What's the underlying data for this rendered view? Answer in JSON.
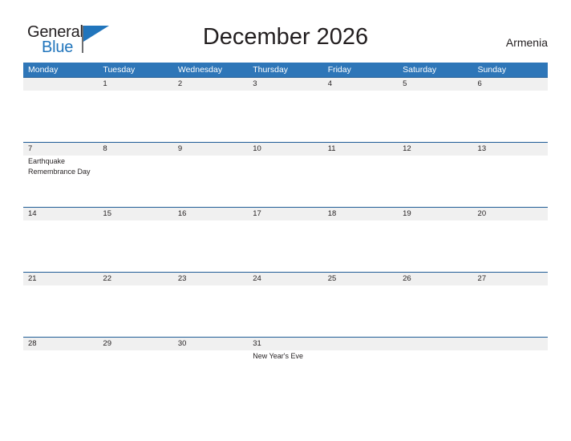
{
  "brand": {
    "name_part1": "General",
    "name_part2": "Blue",
    "flag_icon": "triangle-flag-icon",
    "accent_color": "#2175bc"
  },
  "header": {
    "title": "December 2026",
    "country": "Armenia"
  },
  "colors": {
    "weekday_header_bg": "#2e76b8",
    "weekday_header_text": "#ffffff",
    "date_band_bg": "#f0f0f0",
    "date_band_border": "#1f5c96",
    "text": "#231f20",
    "page_bg": "#ffffff"
  },
  "calendar": {
    "weekdays": [
      "Monday",
      "Tuesday",
      "Wednesday",
      "Thursday",
      "Friday",
      "Saturday",
      "Sunday"
    ],
    "weeks": [
      {
        "days": [
          {
            "number": "",
            "event": ""
          },
          {
            "number": "1",
            "event": ""
          },
          {
            "number": "2",
            "event": ""
          },
          {
            "number": "3",
            "event": ""
          },
          {
            "number": "4",
            "event": ""
          },
          {
            "number": "5",
            "event": ""
          },
          {
            "number": "6",
            "event": ""
          }
        ]
      },
      {
        "days": [
          {
            "number": "7",
            "event": "Earthquake Remembrance Day"
          },
          {
            "number": "8",
            "event": ""
          },
          {
            "number": "9",
            "event": ""
          },
          {
            "number": "10",
            "event": ""
          },
          {
            "number": "11",
            "event": ""
          },
          {
            "number": "12",
            "event": ""
          },
          {
            "number": "13",
            "event": ""
          }
        ]
      },
      {
        "days": [
          {
            "number": "14",
            "event": ""
          },
          {
            "number": "15",
            "event": ""
          },
          {
            "number": "16",
            "event": ""
          },
          {
            "number": "17",
            "event": ""
          },
          {
            "number": "18",
            "event": ""
          },
          {
            "number": "19",
            "event": ""
          },
          {
            "number": "20",
            "event": ""
          }
        ]
      },
      {
        "days": [
          {
            "number": "21",
            "event": ""
          },
          {
            "number": "22",
            "event": ""
          },
          {
            "number": "23",
            "event": ""
          },
          {
            "number": "24",
            "event": ""
          },
          {
            "number": "25",
            "event": ""
          },
          {
            "number": "26",
            "event": ""
          },
          {
            "number": "27",
            "event": ""
          }
        ]
      },
      {
        "days": [
          {
            "number": "28",
            "event": ""
          },
          {
            "number": "29",
            "event": ""
          },
          {
            "number": "30",
            "event": ""
          },
          {
            "number": "31",
            "event": "New Year's Eve"
          },
          {
            "number": "",
            "event": ""
          },
          {
            "number": "",
            "event": ""
          },
          {
            "number": "",
            "event": ""
          }
        ]
      }
    ]
  }
}
